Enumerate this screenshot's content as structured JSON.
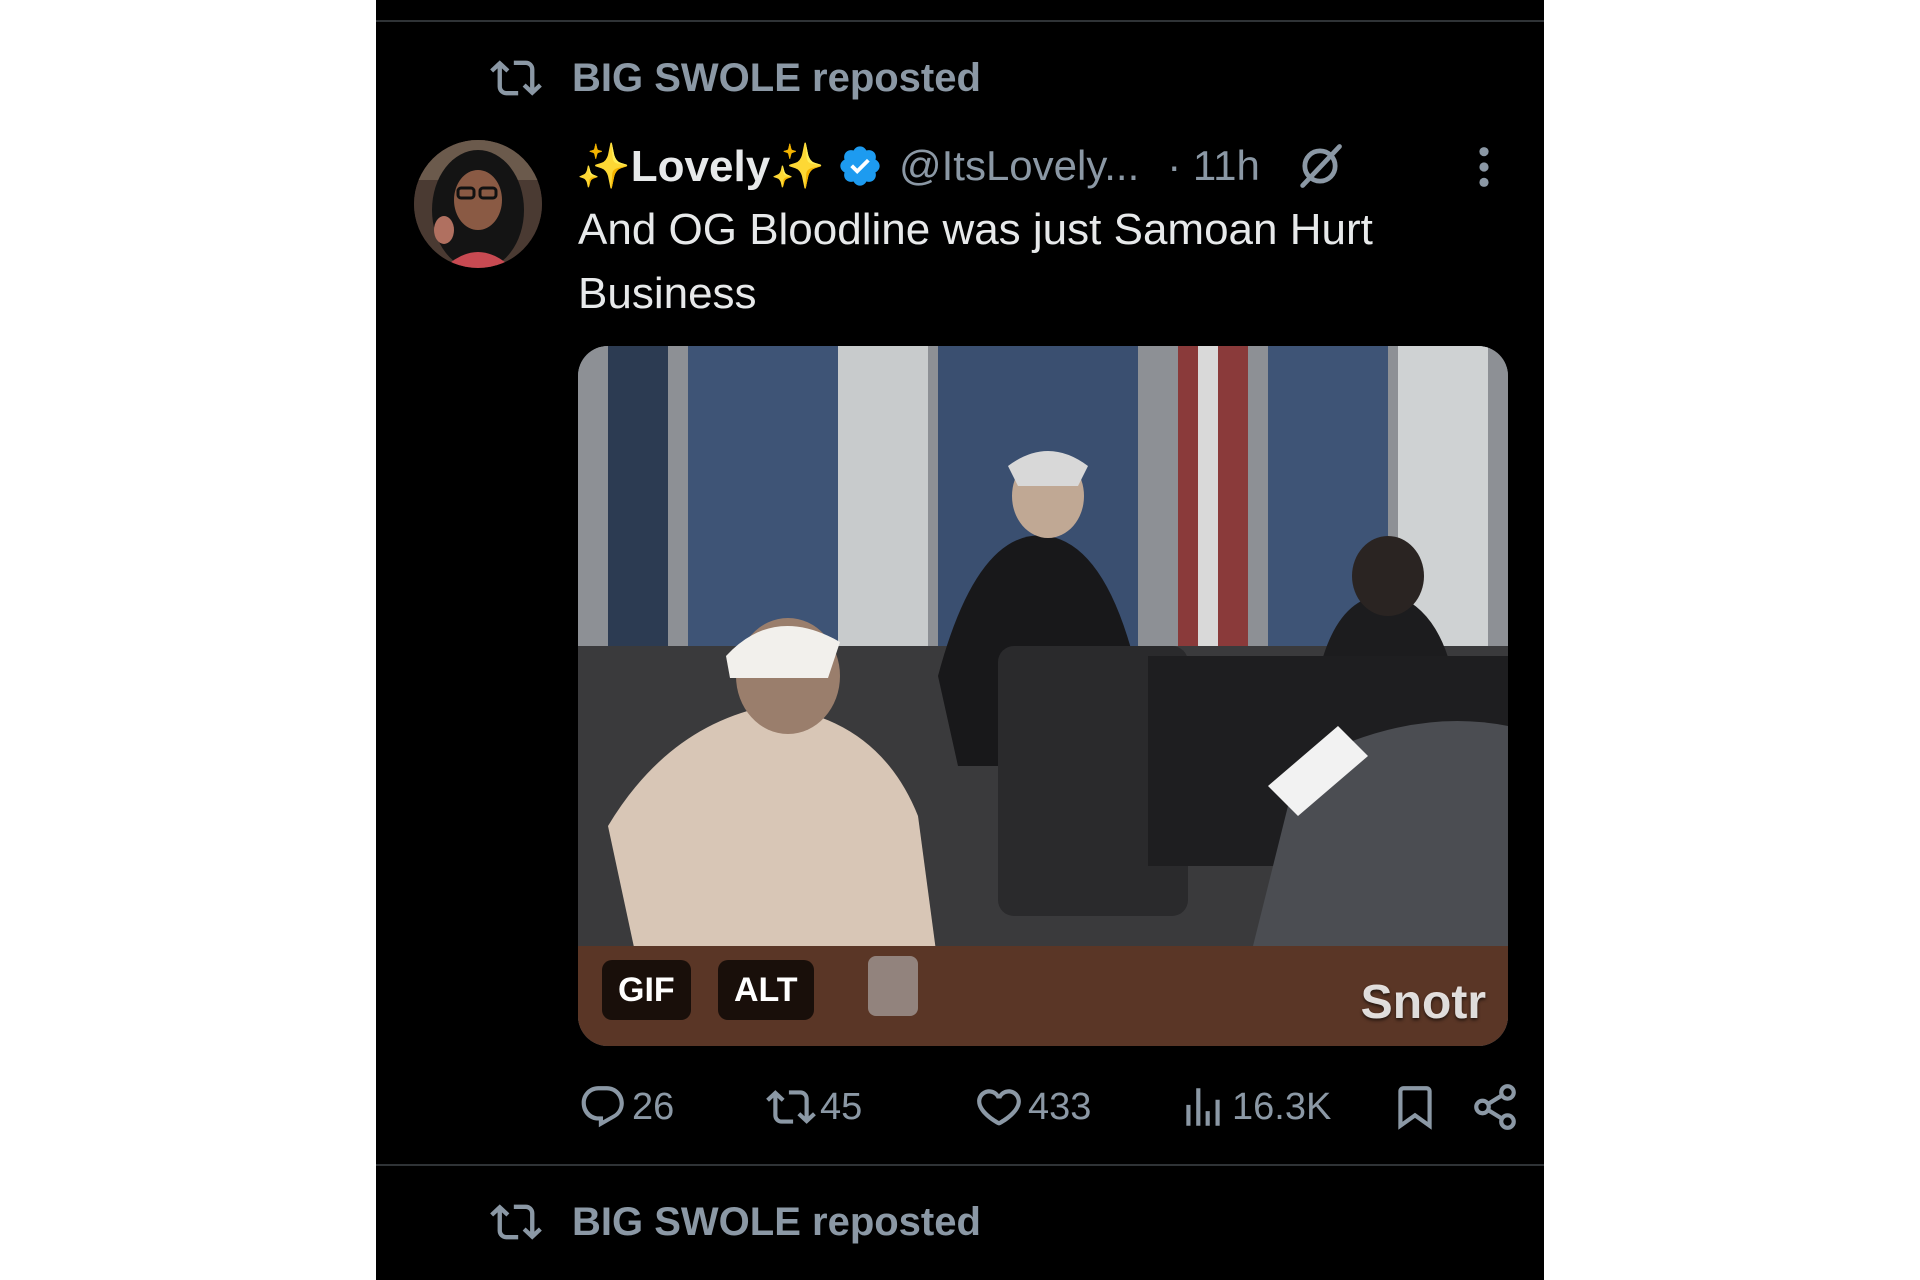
{
  "repost_banner": {
    "text": "BIG SWOLE reposted"
  },
  "repost_banner_next": {
    "text": "BIG SWOLE reposted"
  },
  "tweet": {
    "display_name": "✨Lovely✨",
    "handle": "@ItsLovely...",
    "time": "· 11h",
    "text": "And OG Bloodline was just Samoan Hurt Business",
    "media": {
      "badges": {
        "gif": "GIF",
        "alt": "ALT"
      },
      "watermark": "Snotr"
    },
    "stats": {
      "replies": "26",
      "reposts": "45",
      "likes": "433",
      "views": "16.3K"
    }
  },
  "colors": {
    "background": "#000000",
    "text_primary": "#e7e9ea",
    "text_secondary": "#8b98a5",
    "verified": "#1d9bf0",
    "divider": "#2f3336"
  },
  "icons": {
    "repost": "repost-icon",
    "verified": "verified-badge-icon",
    "grok": "grok-icon",
    "more": "more-vertical-icon",
    "reply": "reply-icon",
    "like": "like-icon",
    "views": "views-icon",
    "bookmark": "bookmark-icon",
    "share": "share-icon"
  }
}
